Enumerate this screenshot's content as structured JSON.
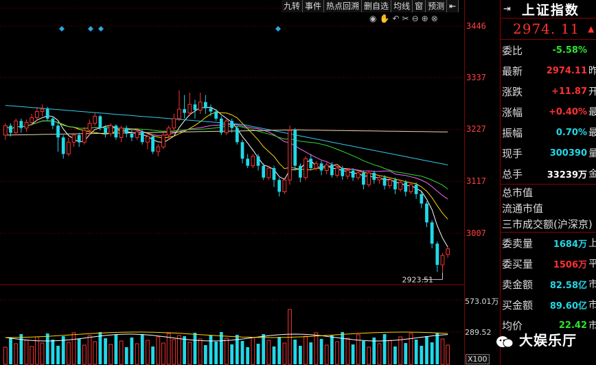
{
  "toolbar": {
    "items": [
      "九转",
      "事件",
      "热点回溯",
      "删自选",
      "均线",
      "窗",
      "预测"
    ],
    "pin_icon": "push-pin-icon"
  },
  "tools": [
    "eye-icon",
    "hand-icon",
    "undo-icon",
    "scissors-icon",
    "zoom-out-icon",
    "zoom-in-icon",
    "close-icon"
  ],
  "price_axis": {
    "ticks": [
      "3446",
      "3337",
      "3227",
      "3117",
      "3007"
    ],
    "low_label": "2923.51",
    "vol_ticks": [
      "573.01万",
      "289.52"
    ],
    "zoom_label": "X100"
  },
  "panel": {
    "icon": "panel-collapse-icon",
    "name": "上证指数",
    "price": "2974. 11",
    "rows": [
      {
        "label": "委比",
        "value": "-5.58%",
        "color": "green",
        "next": ""
      },
      {
        "label": "最新",
        "value": "2974.11",
        "color": "red",
        "next": "昨"
      },
      {
        "label": "涨跌",
        "value": "+11.87",
        "color": "red",
        "next": "开"
      },
      {
        "label": "涨幅",
        "value": "+0.40%",
        "color": "red",
        "next": "最"
      },
      {
        "label": "振幅",
        "value": "0.70%",
        "color": "cyan",
        "next": "最"
      },
      {
        "label": "现手",
        "value": "300390",
        "color": "cyan",
        "next": "量"
      },
      {
        "label": "总手",
        "value": "33239万",
        "color": "white",
        "next": "金"
      }
    ],
    "mcap": [
      "总市值",
      "流通市值",
      "三市成交额(沪深京)"
    ],
    "rows2": [
      {
        "label": "委卖量",
        "value": "1684万",
        "color": "cyan",
        "next": "上"
      },
      {
        "label": "委买量",
        "value": "1506万",
        "color": "red",
        "next": "平"
      },
      {
        "label": "卖金额",
        "value": "82.58亿",
        "color": "cyan",
        "next": "市"
      },
      {
        "label": "买金额",
        "value": "89.60亿",
        "color": "cyan",
        "next": "市"
      },
      {
        "label": "均价",
        "value": "22.42",
        "color": "green",
        "next": "市"
      }
    ]
  },
  "watermark": "大娱乐厅",
  "colors": {
    "up": "#ff3232",
    "down": "#22d8e8",
    "ma5": "#ffffff",
    "ma10": "#ffd700",
    "ma20": "#ff66ff",
    "ma30": "#33dd33",
    "ma60": "#33ccee",
    "ma120": "#e8e0b0"
  },
  "chart_data": {
    "type": "candlestick",
    "y_ticks": [
      3446,
      3337,
      3227,
      3117,
      3007
    ],
    "low_annotation": 2923.51,
    "candles": [
      [
        3215,
        3235,
        3205,
        3240
      ],
      [
        3235,
        3220,
        3212,
        3240
      ],
      [
        3220,
        3245,
        3215,
        3250
      ],
      [
        3245,
        3230,
        3220,
        3250
      ],
      [
        3230,
        3242,
        3222,
        3248
      ],
      [
        3242,
        3252,
        3235,
        3260
      ],
      [
        3252,
        3265,
        3245,
        3275
      ],
      [
        3265,
        3270,
        3255,
        3280
      ],
      [
        3270,
        3250,
        3245,
        3275
      ],
      [
        3250,
        3235,
        3228,
        3255
      ],
      [
        3235,
        3210,
        3180,
        3240
      ],
      [
        3210,
        3175,
        3165,
        3215
      ],
      [
        3175,
        3200,
        3170,
        3210
      ],
      [
        3200,
        3215,
        3190,
        3220
      ],
      [
        3215,
        3200,
        3190,
        3220
      ],
      [
        3200,
        3225,
        3195,
        3232
      ],
      [
        3225,
        3240,
        3215,
        3248
      ],
      [
        3240,
        3255,
        3235,
        3262
      ],
      [
        3255,
        3230,
        3225,
        3258
      ],
      [
        3230,
        3218,
        3210,
        3236
      ],
      [
        3218,
        3235,
        3212,
        3240
      ],
      [
        3235,
        3210,
        3205,
        3238
      ],
      [
        3210,
        3230,
        3200,
        3235
      ],
      [
        3230,
        3218,
        3210,
        3235
      ],
      [
        3218,
        3210,
        3202,
        3225
      ],
      [
        3210,
        3222,
        3205,
        3228
      ],
      [
        3222,
        3200,
        3195,
        3226
      ],
      [
        3200,
        3212,
        3185,
        3216
      ],
      [
        3212,
        3180,
        3175,
        3215
      ],
      [
        3180,
        3190,
        3170,
        3196
      ],
      [
        3190,
        3215,
        3185,
        3220
      ],
      [
        3215,
        3230,
        3205,
        3235
      ],
      [
        3230,
        3250,
        3225,
        3260
      ],
      [
        3250,
        3270,
        3245,
        3310
      ],
      [
        3270,
        3262,
        3250,
        3300
      ],
      [
        3262,
        3280,
        3255,
        3305
      ],
      [
        3280,
        3268,
        3250,
        3290
      ],
      [
        3268,
        3285,
        3260,
        3305
      ],
      [
        3285,
        3272,
        3260,
        3300
      ],
      [
        3272,
        3265,
        3255,
        3280
      ],
      [
        3265,
        3250,
        3245,
        3270
      ],
      [
        3250,
        3220,
        3215,
        3255
      ],
      [
        3220,
        3245,
        3215,
        3250
      ],
      [
        3245,
        3230,
        3220,
        3250
      ],
      [
        3230,
        3200,
        3195,
        3235
      ],
      [
        3200,
        3165,
        3155,
        3205
      ],
      [
        3165,
        3150,
        3145,
        3175
      ],
      [
        3150,
        3170,
        3145,
        3175
      ],
      [
        3170,
        3150,
        3140,
        3175
      ],
      [
        3150,
        3125,
        3120,
        3155
      ],
      [
        3125,
        3145,
        3120,
        3150
      ],
      [
        3145,
        3120,
        3105,
        3150
      ],
      [
        3120,
        3095,
        3085,
        3125
      ],
      [
        3095,
        3120,
        3090,
        3125
      ],
      [
        3120,
        3225,
        3110,
        3235
      ],
      [
        3225,
        3150,
        3140,
        3230
      ],
      [
        3150,
        3125,
        3115,
        3155
      ],
      [
        3125,
        3165,
        3120,
        3170
      ],
      [
        3165,
        3145,
        3140,
        3175
      ],
      [
        3145,
        3155,
        3140,
        3160
      ],
      [
        3155,
        3140,
        3130,
        3160
      ],
      [
        3140,
        3152,
        3132,
        3158
      ],
      [
        3152,
        3130,
        3125,
        3158
      ],
      [
        3130,
        3145,
        3125,
        3150
      ],
      [
        3145,
        3128,
        3120,
        3150
      ],
      [
        3128,
        3140,
        3122,
        3145
      ],
      [
        3140,
        3125,
        3118,
        3145
      ],
      [
        3125,
        3135,
        3120,
        3140
      ],
      [
        3135,
        3110,
        3100,
        3140
      ],
      [
        3110,
        3135,
        3105,
        3140
      ],
      [
        3135,
        3120,
        3112,
        3140
      ],
      [
        3120,
        3125,
        3112,
        3130
      ],
      [
        3125,
        3108,
        3100,
        3130
      ],
      [
        3108,
        3120,
        3102,
        3125
      ],
      [
        3120,
        3100,
        3090,
        3125
      ],
      [
        3100,
        3115,
        3095,
        3120
      ],
      [
        3115,
        3095,
        3085,
        3120
      ],
      [
        3095,
        3110,
        3090,
        3115
      ],
      [
        3110,
        3090,
        3080,
        3115
      ],
      [
        3090,
        3070,
        3060,
        3095
      ],
      [
        3070,
        3030,
        3020,
        3075
      ],
      [
        3030,
        2985,
        2975,
        3035
      ],
      [
        2985,
        2940,
        2925,
        2990
      ],
      [
        2940,
        2960,
        2923,
        2965
      ],
      [
        2962,
        2974,
        2955,
        2978
      ]
    ],
    "volume_ticks": [
      "573.01万",
      "289.52"
    ]
  }
}
